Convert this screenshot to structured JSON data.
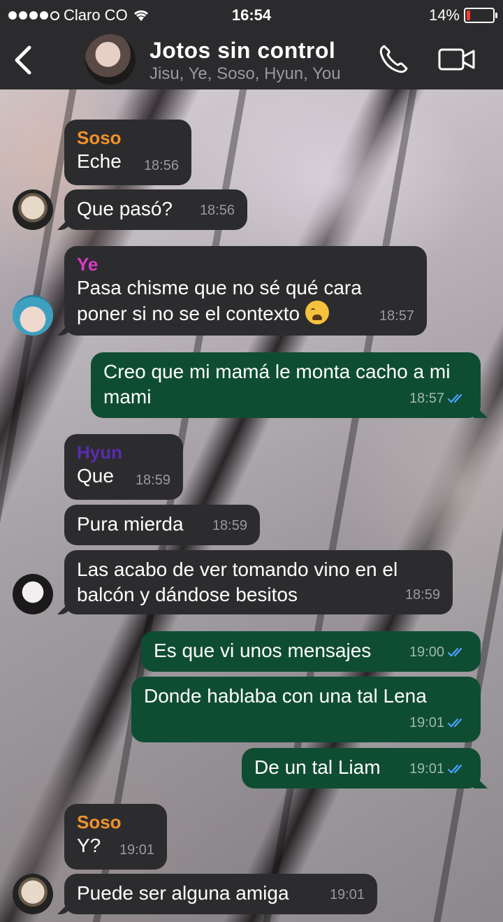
{
  "status_bar": {
    "carrier": "Claro CO",
    "time": "16:54",
    "battery": "14%",
    "battery_level": 0.14,
    "battery_color": "#ff3b30"
  },
  "header": {
    "title": "Jotos sin control",
    "members": "Jisu, Ye, Soso, Hyun, You",
    "back_icon": "chevron-left-icon",
    "call_icon": "phone-icon",
    "video_icon": "video-camera-icon"
  },
  "colors": {
    "incoming_bubble": "#2c2c2e",
    "outgoing_bubble": "#0f4d33",
    "soso": "#f0922b",
    "ye": "#d63ac4",
    "hyun": "#5b2bb0",
    "read_ticks": "#4aa3ff"
  },
  "messages": [
    {
      "sender": "Soso",
      "text": "Eche",
      "time": "18:56"
    },
    {
      "text": "Que pasó?",
      "time": "18:56"
    },
    {
      "sender": "Ye",
      "text": "Pasa chisme que no sé qué cara poner si no se el contexto",
      "time": "18:57"
    },
    {
      "text": "Creo que mi mamá le monta cacho a mi mami",
      "time": "18:57"
    },
    {
      "sender": "Hyun",
      "text": "Que",
      "time": "18:59"
    },
    {
      "text": "Pura mierda",
      "time": "18:59"
    },
    {
      "text": "Las acabo de ver tomando vino en el balcón y dándose besitos",
      "time": "18:59"
    },
    {
      "text": "Es que vi unos mensajes",
      "time": "19:00"
    },
    {
      "text": "Donde hablaba con una tal Lena",
      "time": "19:01"
    },
    {
      "text": "De un tal Liam",
      "time": "19:01"
    },
    {
      "sender": "Soso",
      "text": "Y?",
      "time": "19:01"
    },
    {
      "text": "Puede ser alguna amiga",
      "time": "19:01"
    }
  ]
}
